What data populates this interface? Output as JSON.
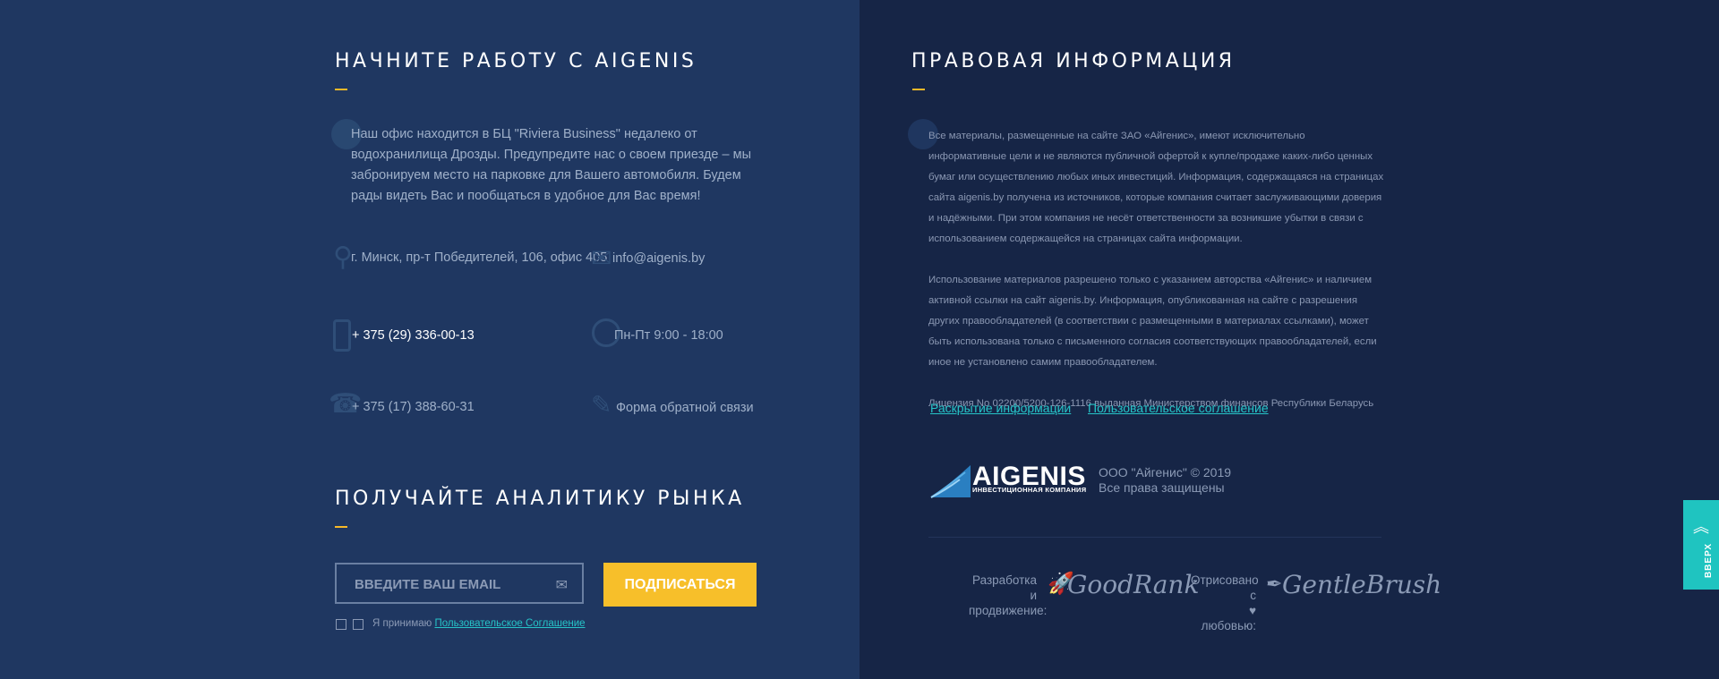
{
  "start": {
    "title": "НАЧНИТЕ РАБОТУ С AIGENIS",
    "intro": "Наш офис находится в БЦ \"Riviera Business\" недалеко от водохранилища Дрозды. Предупредите нас о своем приезде – мы забронируем место на парковке для Вашего автомобиля. Будем рады видеть Вас и пообщаться в удобное для Вас время!",
    "address": "г. Минск, пр-т Победителей, 106, офис 405",
    "email": "info@aigenis.by",
    "phone_mobile": "+ 375 (29) 336-00-13",
    "hours": "Пн-Пт 9:00 - 18:00",
    "phone_landline": "+ 375 (17) 388-60-31",
    "feedback": "Форма обратной связи"
  },
  "subscribe": {
    "title": "ПОЛУЧАЙТЕ АНАЛИТИКУ РЫНКА",
    "placeholder": "ВВЕДИТЕ ВАШ EMAIL",
    "button": "ПОДПИСАТЬСЯ",
    "agree_text": "Я принимаю",
    "agree_link": "Пользовательское Соглашение"
  },
  "legal": {
    "title": "ПРАВОВАЯ ИНФОРМАЦИЯ",
    "p1": "Все материалы, размещенные на сайте ЗАО «Айгенис», имеют исключительно информативные цели и не являются публичной офертой к купле/продаже каких-либо ценных бумаг или осуществлению любых иных инвестиций. Информация, содержащаяся на страницах сайта aigenis.by получена из источников, которые компания считает заслуживающими доверия и надёжными. При этом компания не несёт ответственности за возникшие убытки в связи с использованием содержащейся на страницах сайта информации.",
    "p2": "Использование материалов разрешено только с указанием авторства «Айгенис» и наличием активной ссылки на сайт aigenis.by. Информация, опубликованная на сайте с разрешения других правообладателей (в соответствии с размещенными в материалах ссылками), может быть использована только с письменного согласия соответствующих правообладателей, если иное не установлено самим правообладателем.",
    "p3": "Лицензия No 02200/5200-126-1116 выданная  Министерством финансов Республики Беларусь",
    "link_disclosure": "Раскрытие информации",
    "link_agreement": "Пользовательское соглашение"
  },
  "footer": {
    "logo": "AIGENIS",
    "logo_sub": "ИНВЕСТИЦИОННАЯ КОМПАНИЯ",
    "copy1": "ООО \"Айгенис\" © 2019",
    "copy2": "Все права защищены",
    "dev_label1": "Разработка и",
    "dev_label2": "продвижение:",
    "dev_brand": "GoodRank",
    "draw_label1": "Отрисовано с",
    "draw_label2": "любовью:",
    "draw_brand": "GentleBrush"
  },
  "scroll_up": "ВВЕРХ",
  "colors": {
    "accent": "#f7bf2a",
    "link": "#26c4c8",
    "left_bg": "#1f3761",
    "right_bg": "#162546"
  }
}
